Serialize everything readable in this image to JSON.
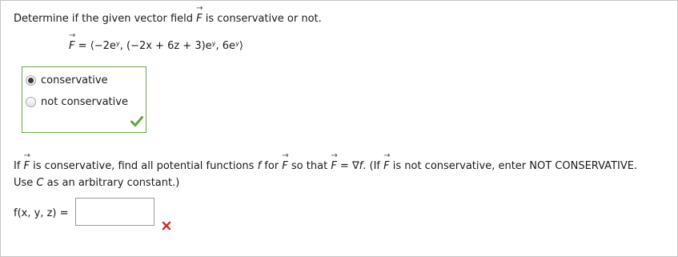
{
  "question1": {
    "prefix": "Determine if the given vector field ",
    "vec": "F",
    "suffix": " is conservative or not."
  },
  "field_equation": {
    "lhs": "F",
    "eq": " = ",
    "expression": "⟨−2eʸ, (−2x + 6z + 3)eʸ, 6eʸ⟩"
  },
  "choices": [
    {
      "label": "conservative",
      "selected": true
    },
    {
      "label": "not conservative",
      "selected": false
    }
  ],
  "status": {
    "correct_color": "#5ea43c",
    "wrong_color": "#d32f2f"
  },
  "question2": {
    "p1": "If ",
    "vec1": "F",
    "p2": " is conservative, find all potential functions ",
    "f1": "f",
    "p3": " for ",
    "vec2": "F",
    "p4": " so that ",
    "vec3": "F",
    "p5": " = ∇",
    "f2": "f",
    "p6": ". (If ",
    "vec4": "F",
    "p7": " is not conservative, enter NOT CONSERVATIVE.",
    "line2a": "Use ",
    "c": "C",
    "line2b": " as an arbitrary constant.)"
  },
  "answer": {
    "label": "f(x, y, z) = ",
    "value": ""
  }
}
